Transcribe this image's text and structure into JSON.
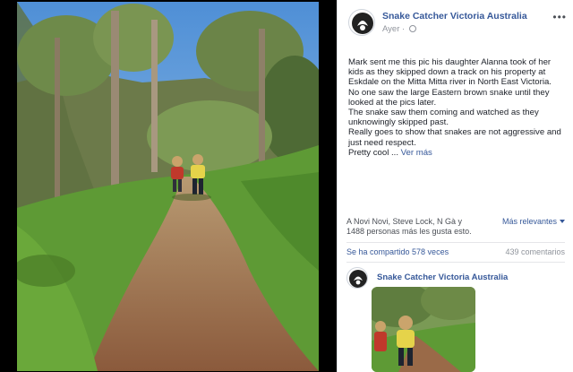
{
  "post": {
    "page_name": "Snake Catcher Victoria Australia",
    "time": "Ayer",
    "more_menu": "•••",
    "text_paragraphs": [
      "Mark sent me this pic his daughter Alanna took of her kids as they skipped down a track on his property at Eskdale on the Mitta Mitta river in North East Victoria.",
      "No one saw the large Eastern brown snake until they looked at the pics later.",
      "The snake saw them coming and watched as they unknowingly skipped past.",
      "Really goes to show that snakes are not aggressive and just need respect.",
      "Pretty cool ..."
    ],
    "see_more": "Ver más"
  },
  "reactions": {
    "text": "A Novi Novi, Steve Lock, N Gà y 1488 personas más les gusta esto.",
    "sort_label": "Más relevantes"
  },
  "stats": {
    "shares": "Se ha compartido 578 veces",
    "comments": "439 comentarios"
  },
  "shared_post": {
    "page_name": "Snake Catcher Victoria Australia"
  },
  "icons": [
    "avatar-logo-icon",
    "globe-icon",
    "more-options-icon",
    "caret-down-icon"
  ],
  "colors": {
    "link_blue": "#365899",
    "text": "#1d2129",
    "muted": "#90949c",
    "viewer_bg": "#000000"
  }
}
